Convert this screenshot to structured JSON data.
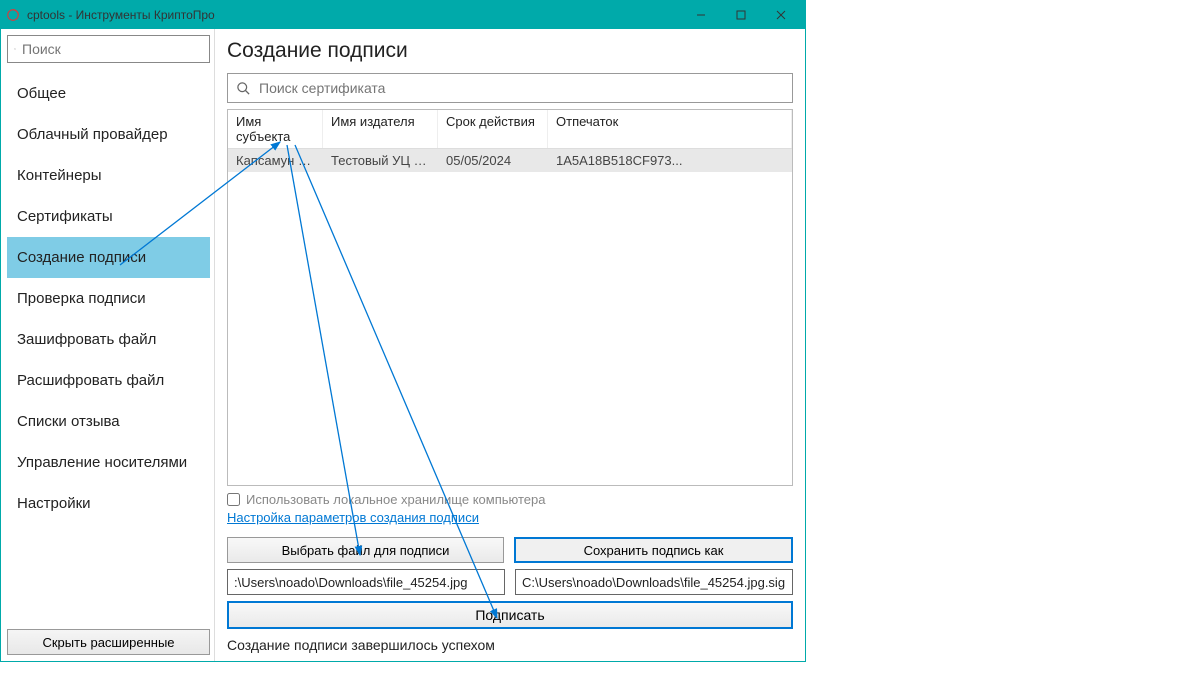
{
  "window": {
    "title": "cptools - Инструменты КриптоПро"
  },
  "sidebar": {
    "search_placeholder": "Поиск",
    "items": [
      {
        "label": "Общее"
      },
      {
        "label": "Облачный провайдер"
      },
      {
        "label": "Контейнеры"
      },
      {
        "label": "Сертификаты"
      },
      {
        "label": "Создание подписи"
      },
      {
        "label": "Проверка подписи"
      },
      {
        "label": "Зашифровать файл"
      },
      {
        "label": "Расшифровать файл"
      },
      {
        "label": "Списки отзыва"
      },
      {
        "label": "Управление носителями"
      },
      {
        "label": "Настройки"
      }
    ],
    "hide_extended_label": "Скрыть расширенные",
    "selected_index": 4
  },
  "main": {
    "title": "Создание подписи",
    "cert_search_placeholder": "Поиск сертификата",
    "table": {
      "headers": {
        "subject": "Имя субъекта",
        "issuer": "Имя издателя",
        "expiry": "Срок действия",
        "fingerprint": "Отпечаток"
      },
      "rows": [
        {
          "subject": "Капсамун Пр...",
          "issuer": "Тестовый УЦ ОО...",
          "expiry": "05/05/2024",
          "fingerprint": "1A5A18B518CF973..."
        }
      ]
    },
    "local_store_label": "Использовать локальное хранилище компьютера",
    "params_link": "Настройка параметров создания подписи",
    "choose_file_label": "Выбрать файл для подписи",
    "save_sig_label": "Сохранить подпись как",
    "input_path": ":\\Users\\noado\\Downloads\\file_45254.jpg",
    "output_path": "C:\\Users\\noado\\Downloads\\file_45254.jpg.sig",
    "sign_label": "Подписать",
    "status": "Создание подписи завершилось успехом"
  }
}
